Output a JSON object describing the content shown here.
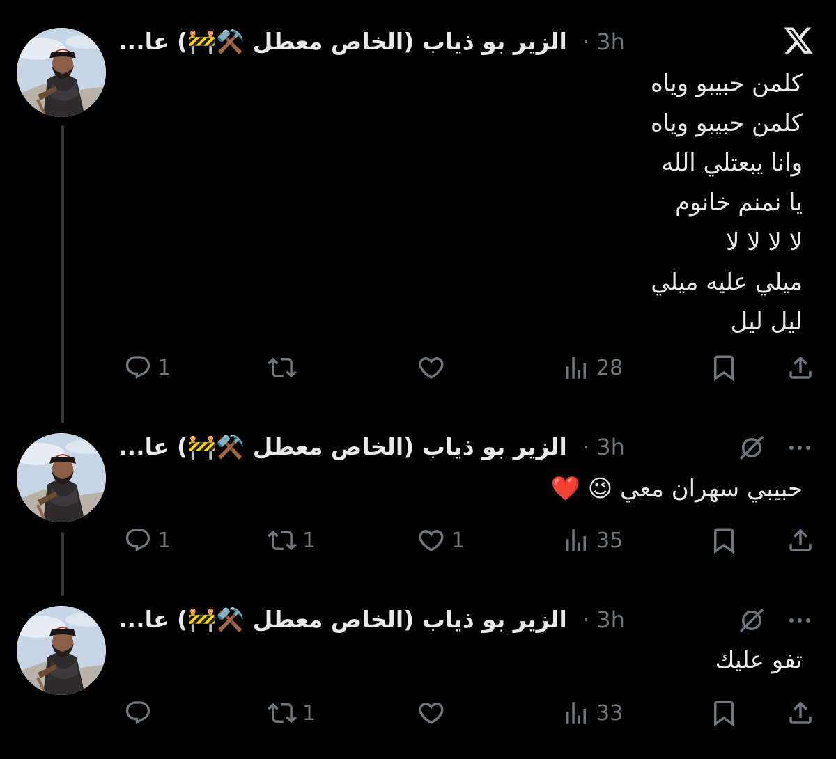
{
  "tweets": [
    {
      "author": "الزير بو ذياب (الخاص معطل ⚒️🚧) عا...",
      "time": "· 3h",
      "header_icons": [
        "x-logo-icon"
      ],
      "lines": [
        "كلمن حبيبو وياه",
        "كلمن حبيبو وياه",
        "وانا يبعتلي الله",
        "يا نمنم خانوم",
        "لا لا لا لا",
        "ميلي عليه ميلي",
        "ليل ليل"
      ],
      "stats": {
        "replies": "1",
        "reposts": "",
        "likes": "",
        "views": "28"
      }
    },
    {
      "author": "الزير بو ذياب (الخاص معطل ⚒️🚧) عا...",
      "time": "· 3h",
      "header_icons": [
        "slashed-circle-icon",
        "more-options-icon"
      ],
      "lines": [
        "حبيبي سهران معي 😉 ❤️"
      ],
      "stats": {
        "replies": "1",
        "reposts": "1",
        "likes": "1",
        "views": "35"
      }
    },
    {
      "author": "الزير بو ذياب (الخاص معطل ⚒️🚧) عا...",
      "time": "· 3h",
      "header_icons": [
        "slashed-circle-icon",
        "more-options-icon"
      ],
      "lines": [
        "تفو عليك"
      ],
      "stats": {
        "replies": "",
        "reposts": "1",
        "likes": "",
        "views": "33"
      }
    }
  ],
  "colors": {
    "background": "#000000",
    "text": "#e7e9ea",
    "secondary": "#71767b",
    "thread_line": "#333639"
  }
}
